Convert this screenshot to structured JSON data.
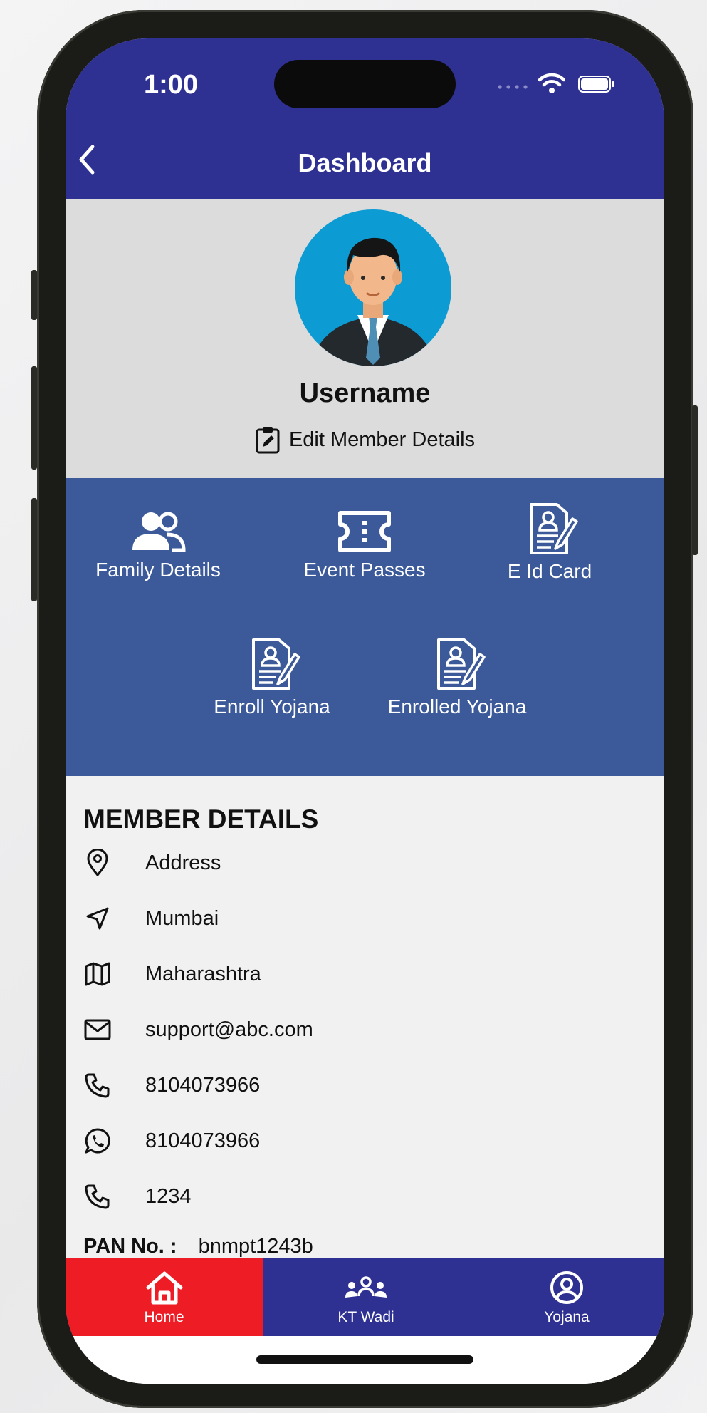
{
  "status_bar": {
    "time": "1:00"
  },
  "header": {
    "title": "Dashboard"
  },
  "profile": {
    "username": "Username",
    "edit_label": "Edit Member Details"
  },
  "actions": [
    {
      "label": "Family Details",
      "icon": "family-icon"
    },
    {
      "label": "Event Passes",
      "icon": "ticket-icon"
    },
    {
      "label": "E Id Card",
      "icon": "id-card-icon"
    },
    {
      "label": "Enroll Yojana",
      "icon": "form-icon"
    },
    {
      "label": "Enrolled Yojana",
      "icon": "form-icon"
    }
  ],
  "member_details": {
    "title": "MEMBER DETAILS",
    "rows": [
      {
        "icon": "location-pin-icon",
        "value": "Address"
      },
      {
        "icon": "navigation-icon",
        "value": "Mumbai"
      },
      {
        "icon": "map-icon",
        "value": "Maharashtra"
      },
      {
        "icon": "mail-icon",
        "value": "support@abc.com"
      },
      {
        "icon": "phone-icon",
        "value": "8104073966"
      },
      {
        "icon": "whatsapp-icon",
        "value": "8104073966"
      },
      {
        "icon": "phone-icon",
        "value": "1234"
      }
    ],
    "pan_label": "PAN No. :",
    "pan_value": "bnmpt1243b"
  },
  "tabs": [
    {
      "label": "Home",
      "icon": "home-icon",
      "active": true
    },
    {
      "label": "KT Wadi",
      "icon": "group-icon",
      "active": false
    },
    {
      "label": "Yojana",
      "icon": "user-circle-icon",
      "active": false
    }
  ],
  "colors": {
    "primary": "#2e3192",
    "action_bg": "#3c5a99",
    "active_tab": "#ee1c25",
    "profile_bg": "#dcdcdc"
  }
}
